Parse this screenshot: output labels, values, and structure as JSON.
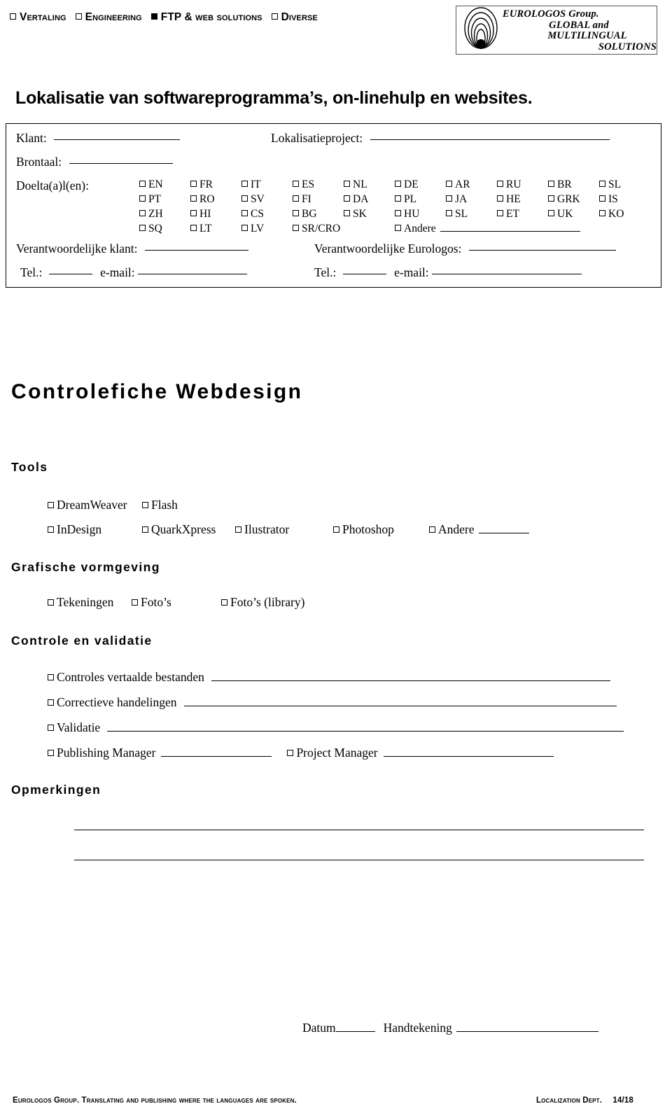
{
  "topbar": {
    "items": [
      {
        "label": "Vertaling",
        "checked": false
      },
      {
        "label": "Engineering",
        "checked": false
      },
      {
        "label": "FTP & web solutions",
        "checked": true
      },
      {
        "label": "Diverse",
        "checked": false
      }
    ]
  },
  "logo": {
    "line1": "EUROLOGOS Group.",
    "line2": "GLOBAL and",
    "line3": "MULTILINGUAL",
    "line4": "SOLUTIONS"
  },
  "page_title": "Lokalisatie van softwareprogramma’s, on-linehulp en websites.",
  "form": {
    "klant_label": "Klant:",
    "project_label": "Lokalisatieproject:",
    "brontaal_label": "Brontaal:",
    "doeltaal_label": "Doelta(a)l(en):",
    "languages": [
      "EN",
      "FR",
      "IT",
      "ES",
      "NL",
      "DE",
      "AR",
      "RU",
      "BR",
      "SL",
      "PT",
      "RO",
      "SV",
      "FI",
      "DA",
      "PL",
      "JA",
      "HE",
      "GRK",
      "IS",
      "ZH",
      "HI",
      "CS",
      "BG",
      "SK",
      "HU",
      "SL",
      "ET",
      "UK",
      "KO",
      "SQ",
      "LT",
      "LV",
      "SR/CRO"
    ],
    "andere_label": "Andere",
    "resp_klant_label": "Verantwoordelijke klant:",
    "resp_eurologos_label": "Verantwoordelijke Eurologos:",
    "tel_label": "Tel.:",
    "email_label": "e-mail:"
  },
  "main_heading": "Controlefiche Webdesign",
  "sections": {
    "tools": {
      "heading": "Tools",
      "row1": [
        "DreamWeaver",
        "Flash"
      ],
      "row2": [
        "InDesign",
        "QuarkXpress",
        "Ilustrator",
        "Photoshop"
      ],
      "andere_label": "Andere"
    },
    "grafische": {
      "heading": "Grafische vormgeving",
      "items": [
        "Tekeningen",
        "Foto’s",
        "Foto’s (library)"
      ]
    },
    "controle": {
      "heading": "Controle en validatie",
      "items": [
        "Controles vertaalde bestanden",
        "Correctieve handelingen",
        "Validatie"
      ],
      "publishing_manager": "Publishing Manager",
      "project_manager": "Project Manager"
    },
    "opmerkingen": {
      "heading": "Opmerkingen"
    }
  },
  "signature": {
    "datum_label": "Datum",
    "handtekening_label": "Handtekening"
  },
  "footer": {
    "left": "Eurologos Group. Translating and publishing where the languages are spoken.",
    "right": "Localization Dept.",
    "page": "14/18"
  }
}
